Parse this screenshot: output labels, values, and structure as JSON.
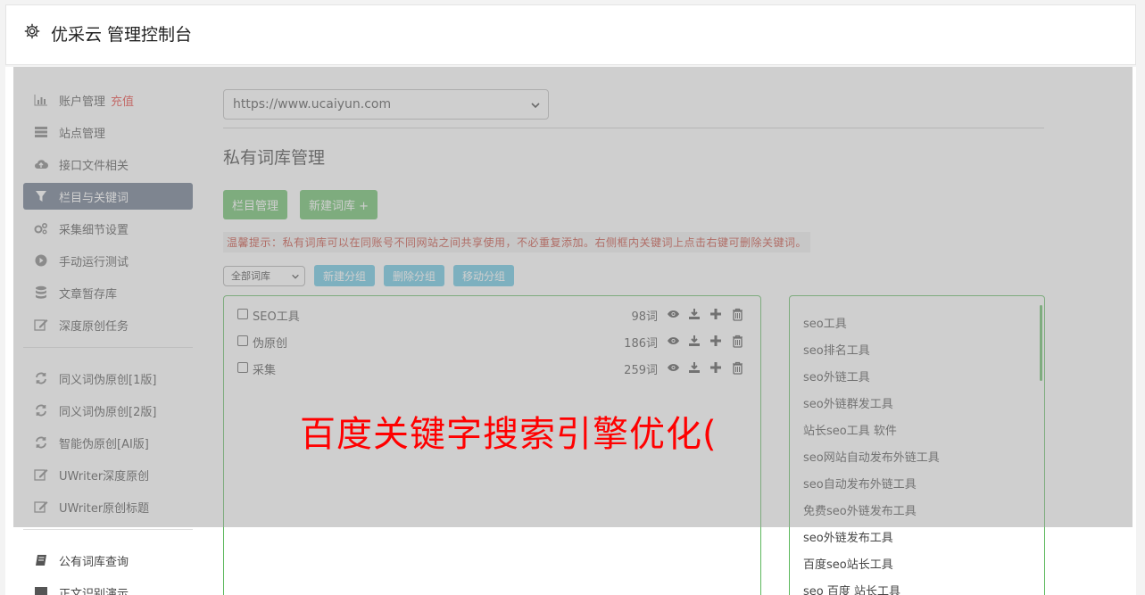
{
  "header": {
    "title": "优采云 管理控制台",
    "icon": "gear-icon"
  },
  "sidebar": {
    "items": [
      {
        "label": "账户管理",
        "badge": "充值",
        "icon": "bar-chart-icon"
      },
      {
        "label": "站点管理",
        "icon": "server-icon"
      },
      {
        "label": "接口文件相关",
        "icon": "cloud-upload-icon"
      },
      {
        "label": "栏目与关键词",
        "icon": "filter-icon",
        "active": true
      },
      {
        "label": "采集细节设置",
        "icon": "gears-icon"
      },
      {
        "label": "手动运行测试",
        "icon": "play-icon"
      },
      {
        "label": "文章暂存库",
        "icon": "database-icon"
      },
      {
        "label": "深度原创任务",
        "icon": "edit-icon"
      }
    ],
    "items2": [
      {
        "label": "同义词伪原创[1版]",
        "icon": "refresh-icon"
      },
      {
        "label": "同义词伪原创[2版]",
        "icon": "refresh-icon"
      },
      {
        "label": "智能伪原创[AI版]",
        "icon": "refresh-icon"
      },
      {
        "label": "UWriter深度原创",
        "icon": "edit-icon"
      },
      {
        "label": "UWriter原创标题",
        "icon": "edit-icon"
      }
    ],
    "items3": [
      {
        "label": "公有词库查询",
        "icon": "book-icon"
      },
      {
        "label": "正文识别演示",
        "icon": "monitor-icon"
      }
    ]
  },
  "main": {
    "site_select": "https://www.ucaiyun.com",
    "section_title": "私有词库管理",
    "btn_columns": "栏目管理",
    "btn_new_lib": "新建词库 +",
    "tip": "温馨提示：私有词库可以在同账号不同网站之间共享使用，不必重复添加。右侧框内关键词上点击右键可删除关键词。",
    "group_select": "全部词库",
    "btn_new_group": "新建分组",
    "btn_delete_group": "删除分组",
    "btn_move_group": "移动分组",
    "libraries": [
      {
        "name": "SEO工具",
        "count": "98词"
      },
      {
        "name": "伪原创",
        "count": "186词"
      },
      {
        "name": "采集",
        "count": "259词"
      }
    ],
    "keywords": [
      "seo工具",
      "seo排名工具",
      "seo外链工具",
      "seo外链群发工具",
      "站长seo工具 软件",
      "seo网站自动发布外链工具",
      "seo自动发布外链工具",
      "免费seo外链发布工具",
      "seo外链发布工具",
      "百度seo站长工具",
      "seo 百度 站长工具"
    ]
  },
  "watermark": "百度关键字搜索引擎优化(",
  "colors": {
    "active_nav": "#5c6b80",
    "green": "#5cb85c",
    "blue": "#5bc0de",
    "watermark": "#ff0000",
    "recharge": "#e53935"
  }
}
